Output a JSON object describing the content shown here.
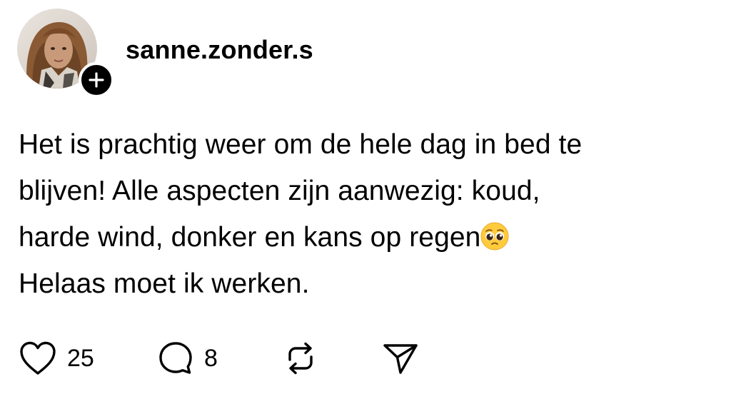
{
  "post": {
    "author": {
      "username": "sanne.zonder.s",
      "avatar_icon": "profile-photo",
      "follow_icon": "plus-icon"
    },
    "text_lines": [
      "Het is prachtig weer om de hele dag in bed te",
      "blijven! Alle aspecten zijn aanwezig: koud,",
      "harde wind, donker en kans op regen",
      "Helaas moet ik werken."
    ],
    "emoji": "pleading-face-emoji",
    "actions": {
      "like": {
        "icon": "heart-icon",
        "count": "25"
      },
      "reply": {
        "icon": "comment-icon",
        "count": "8"
      },
      "repost": {
        "icon": "repost-icon"
      },
      "share": {
        "icon": "send-icon"
      }
    }
  },
  "colors": {
    "text": "#000000",
    "background": "#ffffff",
    "badge": "#000000",
    "emoji": "#FFCB3D"
  }
}
